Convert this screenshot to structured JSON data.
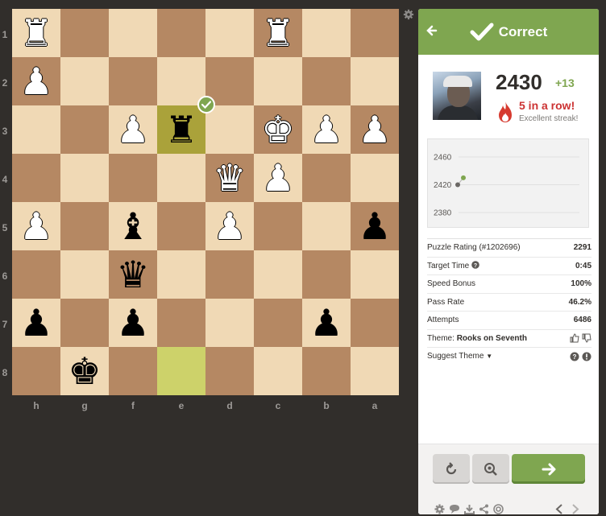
{
  "board": {
    "ranks": [
      "1",
      "2",
      "3",
      "4",
      "5",
      "6",
      "7",
      "8"
    ],
    "files": [
      "h",
      "g",
      "f",
      "e",
      "d",
      "c",
      "b",
      "a"
    ],
    "squares": [
      [
        "wR",
        "",
        "",
        "",
        "",
        "wR",
        "",
        ""
      ],
      [
        "wP",
        "",
        "",
        "",
        "",
        "",
        "",
        ""
      ],
      [
        "",
        "",
        "wP",
        "bR",
        "",
        "wK",
        "wP",
        "wP"
      ],
      [
        "",
        "",
        "",
        "",
        "wQ",
        "wP",
        "",
        ""
      ],
      [
        "wP",
        "",
        "bB",
        "",
        "wP",
        "",
        "",
        "bP"
      ],
      [
        "",
        "",
        "bQ",
        "",
        "",
        "",
        "",
        ""
      ],
      [
        "bP",
        "",
        "bP",
        "",
        "",
        "",
        "bP",
        ""
      ],
      [
        "",
        "bK",
        "",
        "",
        "",
        "",
        "",
        ""
      ]
    ],
    "highlight_from": "e8",
    "highlight_to": "e3",
    "check_on": "e3"
  },
  "header": {
    "title": "Correct",
    "color": "#7fa650"
  },
  "user": {
    "rating": "2430",
    "delta": "+13",
    "streak": "5 in a row!",
    "streak_sub": "Excellent streak!"
  },
  "graph": {
    "y_labels": [
      "2460",
      "2420",
      "2380"
    ],
    "y_range": [
      2380,
      2460
    ],
    "points": [
      2420,
      2430
    ]
  },
  "stats": [
    {
      "label": "Puzzle Rating (#1202696)",
      "value": "2291"
    },
    {
      "label": "Target Time",
      "value": "0:45"
    },
    {
      "label": "Speed Bonus",
      "value": "100%"
    },
    {
      "label": "Pass Rate",
      "value": "46.2%"
    },
    {
      "label": "Attempts",
      "value": "6486"
    }
  ],
  "theme": {
    "prefix": "Theme:",
    "name": "Rooks on Seventh"
  },
  "suggest_theme": "Suggest Theme",
  "icons": {
    "back": "arrow-left-icon",
    "correct": "checkmark-icon",
    "streak": "flame-icon",
    "retry": "retry-icon",
    "analysis": "analysis-icon",
    "next": "arrow-right-icon"
  }
}
